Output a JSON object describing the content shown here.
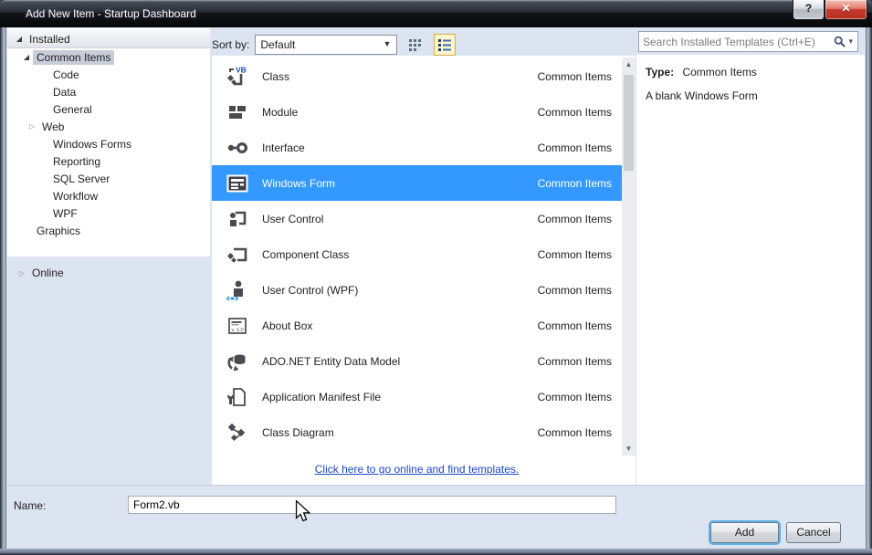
{
  "window": {
    "title": "Add New Item - Startup Dashboard",
    "help_glyph": "?",
    "close_glyph": "✕"
  },
  "toolbar": {
    "sort_by_label": "Sort by:",
    "sort_value": "Default"
  },
  "search": {
    "placeholder": "Search Installed Templates (Ctrl+E)"
  },
  "sidebar": {
    "installed_label": "Installed",
    "online_label": "Online",
    "children": [
      {
        "label": "Common Items",
        "selected": true,
        "expanded": true
      },
      {
        "label": "Code"
      },
      {
        "label": "Data"
      },
      {
        "label": "General"
      },
      {
        "label": "Web",
        "collapsed": true
      },
      {
        "label": "Windows Forms"
      },
      {
        "label": "Reporting"
      },
      {
        "label": "SQL Server"
      },
      {
        "label": "Workflow"
      },
      {
        "label": "WPF"
      },
      {
        "label": "Graphics"
      }
    ]
  },
  "templates": {
    "items": [
      {
        "name": "Class",
        "category": "Common Items"
      },
      {
        "name": "Module",
        "category": "Common Items"
      },
      {
        "name": "Interface",
        "category": "Common Items"
      },
      {
        "name": "Windows Form",
        "category": "Common Items",
        "selected": true
      },
      {
        "name": "User Control",
        "category": "Common Items"
      },
      {
        "name": "Component Class",
        "category": "Common Items"
      },
      {
        "name": "User Control (WPF)",
        "category": "Common Items"
      },
      {
        "name": "About Box",
        "category": "Common Items"
      },
      {
        "name": "ADO.NET Entity Data Model",
        "category": "Common Items"
      },
      {
        "name": "Application Manifest File",
        "category": "Common Items"
      },
      {
        "name": "Class Diagram",
        "category": "Common Items"
      }
    ],
    "online_link": "Click here to go online and find templates."
  },
  "details": {
    "type_label": "Type:",
    "type_value": "Common Items",
    "description": "A blank Windows Form"
  },
  "footer": {
    "name_label": "Name:",
    "name_value": "Form2.vb",
    "add_label": "Add",
    "cancel_label": "Cancel"
  },
  "colors": {
    "selection_blue": "#3399fe",
    "link_blue": "#1d47c7",
    "dialog_bg": "#dde4f1"
  }
}
